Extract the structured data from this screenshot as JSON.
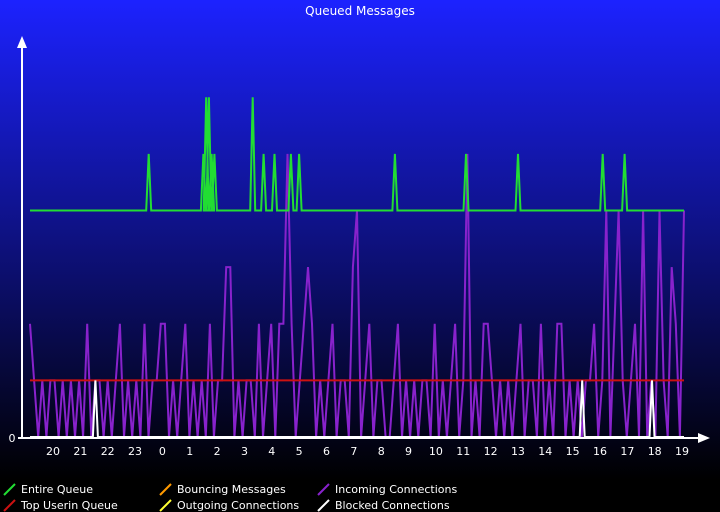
{
  "chart_data": {
    "type": "line",
    "title": "Queued Messages",
    "xlabel": "",
    "ylabel": "",
    "y_tick_labels": [
      "0"
    ],
    "x_tick_labels": [
      "20",
      "21",
      "22",
      "23",
      "0",
      "1",
      "2",
      "3",
      "4",
      "5",
      "6",
      "7",
      "8",
      "9",
      "10",
      "11",
      "12",
      "13",
      "14",
      "15",
      "16",
      "17",
      "18",
      "19"
    ],
    "ylim": [
      0,
      6.8
    ],
    "grid": false,
    "legend_position": "bottom",
    "background": {
      "top": "#1c22ff",
      "bottom": "#000000"
    },
    "legend": [
      {
        "name": "Entire Queue",
        "color": "#22dd33"
      },
      {
        "name": "Top Userin Queue",
        "color": "#cc1111"
      },
      {
        "name": "Bouncing Messages",
        "color": "#ff9900"
      },
      {
        "name": "Outgoing Connections",
        "color": "#ffff33"
      },
      {
        "name": "Incoming Connections",
        "color": "#8822cc"
      },
      {
        "name": "Blocked Connections",
        "color": "#ffffff"
      }
    ],
    "series": [
      {
        "name": "Entire Queue",
        "color": "#22dd33",
        "default": 4,
        "peaks": [
          {
            "x": 23.5,
            "y": 5
          },
          {
            "x": 1.5,
            "y": 5
          },
          {
            "x": 1.6,
            "y": 6
          },
          {
            "x": 1.7,
            "y": 6
          },
          {
            "x": 1.8,
            "y": 5
          },
          {
            "x": 1.9,
            "y": 5
          },
          {
            "x": 3.3,
            "y": 6
          },
          {
            "x": 3.7,
            "y": 5
          },
          {
            "x": 4.1,
            "y": 5
          },
          {
            "x": 4.7,
            "y": 5
          },
          {
            "x": 5.0,
            "y": 5
          },
          {
            "x": 8.5,
            "y": 5
          },
          {
            "x": 11.1,
            "y": 5
          },
          {
            "x": 13.0,
            "y": 5
          },
          {
            "x": 16.1,
            "y": 5
          },
          {
            "x": 16.9,
            "y": 5
          }
        ]
      },
      {
        "name": "Top Userin Queue",
        "color": "#cc1111",
        "default": 1,
        "peaks": []
      },
      {
        "name": "Bouncing Messages",
        "color": "#ff9900",
        "default": 0,
        "peaks": []
      },
      {
        "name": "Outgoing Connections",
        "color": "#ffff33",
        "default": 0,
        "peaks": []
      },
      {
        "name": "Incoming Connections",
        "color": "#8822cc",
        "samples": [
          2,
          1,
          0,
          1,
          0,
          1,
          1,
          0,
          1,
          0,
          1,
          0,
          1,
          0,
          2,
          0,
          1,
          1,
          0,
          1,
          0,
          1,
          2,
          0,
          1,
          0,
          1,
          0,
          2,
          0,
          1,
          1,
          2,
          2,
          0,
          1,
          0,
          1,
          2,
          0,
          1,
          0,
          1,
          0,
          2,
          0,
          1,
          1,
          3,
          3,
          0,
          1,
          0,
          1,
          1,
          0,
          2,
          0,
          1,
          2,
          0,
          2,
          2,
          5,
          2,
          0,
          1,
          2,
          3,
          2,
          0,
          1,
          0,
          1,
          2,
          0,
          1,
          1,
          0,
          3,
          4,
          0,
          1,
          2,
          0,
          1,
          1,
          0,
          0,
          1,
          2,
          0,
          1,
          0,
          1,
          0,
          1,
          1,
          0,
          2,
          0,
          1,
          0,
          1,
          2,
          0,
          1,
          5,
          0,
          1,
          0,
          2,
          2,
          1,
          0,
          1,
          0,
          1,
          0,
          1,
          2,
          0,
          1,
          1,
          0,
          2,
          0,
          1,
          0,
          2,
          2,
          0,
          1,
          0,
          1,
          0,
          1,
          1,
          2,
          0,
          1,
          4,
          0,
          2,
          4,
          1,
          0,
          1,
          2,
          0,
          4,
          0,
          1,
          0,
          4,
          1,
          0,
          3,
          2,
          0,
          4
        ]
      },
      {
        "name": "Blocked Connections",
        "color": "#ffffff",
        "default": 0,
        "peaks": [
          {
            "x": 21.55,
            "y": 1
          },
          {
            "x": 15.35,
            "y": 1
          },
          {
            "x": 17.9,
            "y": 1
          }
        ]
      }
    ]
  }
}
